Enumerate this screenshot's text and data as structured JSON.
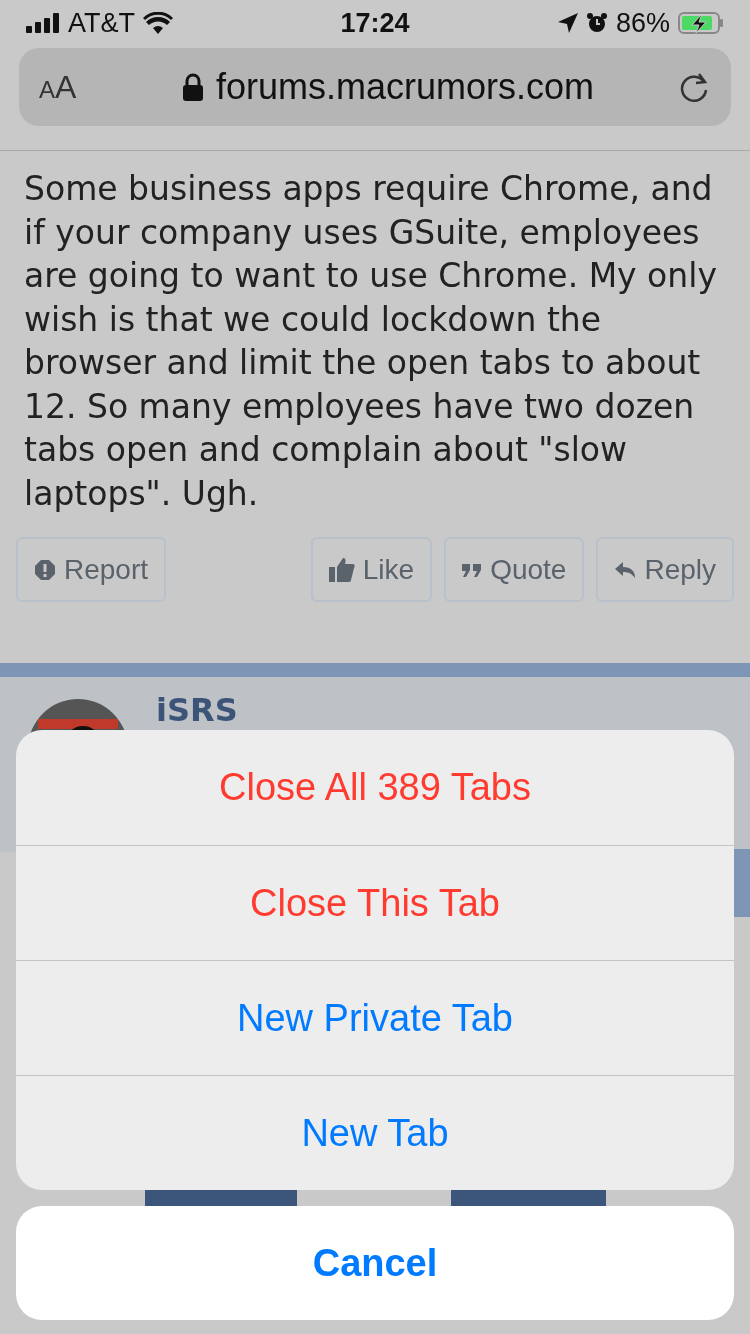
{
  "status_bar": {
    "carrier": "AT&T",
    "time": "17:24",
    "battery": "86%",
    "charging": true
  },
  "address_bar": {
    "text_size": "AA",
    "url": "forums.macrumors.com",
    "secure": true
  },
  "post": {
    "text": "Some business apps require Chrome, and if your company uses GSuite, employees are going to want to use Chrome. My only wish is that we could lockdown the browser and limit the open tabs to about 12. So many employees have two dozen tabs open and complain about \"slow laptops\". Ugh.",
    "actions": [
      {
        "label": "Report",
        "kind": "report"
      },
      {
        "label": "Like",
        "kind": "like"
      },
      {
        "label": "Quote",
        "kind": "quote"
      },
      {
        "label": "Reply",
        "kind": "reply"
      }
    ]
  },
  "next_post": {
    "author": "iSRS"
  },
  "action_sheet": {
    "actions": [
      {
        "label": "Close All 389 Tabs",
        "destructive": true
      },
      {
        "label": "Close This Tab",
        "destructive": true
      },
      {
        "label": "New Private Tab",
        "destructive": false
      },
      {
        "label": "New Tab",
        "destructive": false
      }
    ],
    "cancel": "Cancel"
  }
}
